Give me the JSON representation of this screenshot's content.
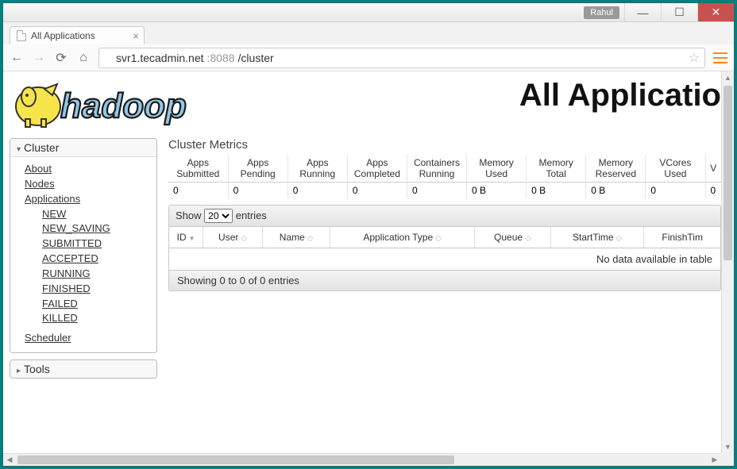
{
  "window": {
    "user_badge": "Rahul"
  },
  "browser": {
    "tab_title": "All Applications",
    "url_host": "svr1.tecadmin.net",
    "url_port": ":8088",
    "url_path": "/cluster"
  },
  "page": {
    "title": "All Applicatio",
    "logo_text": "hadoop"
  },
  "sidebar": {
    "cluster_label": "Cluster",
    "tools_label": "Tools",
    "links": {
      "about": "About",
      "nodes": "Nodes",
      "applications": "Applications",
      "scheduler": "Scheduler"
    },
    "app_states": [
      "NEW",
      "NEW_SAVING",
      "SUBMITTED",
      "ACCEPTED",
      "RUNNING",
      "FINISHED",
      "FAILED",
      "KILLED"
    ]
  },
  "metrics": {
    "section_title": "Cluster Metrics",
    "headers": [
      "Apps Submitted",
      "Apps Pending",
      "Apps Running",
      "Apps Completed",
      "Containers Running",
      "Memory Used",
      "Memory Total",
      "Memory Reserved",
      "VCores Used",
      "V"
    ],
    "values": [
      "0",
      "0",
      "0",
      "0",
      "0",
      "0 B",
      "0 B",
      "0 B",
      "0",
      "0"
    ]
  },
  "datatable": {
    "show_label_pre": "Show",
    "show_label_post": "entries",
    "page_size": "20",
    "columns": [
      "ID",
      "User",
      "Name",
      "Application Type",
      "Queue",
      "StartTime",
      "FinishTim"
    ],
    "empty_text": "No data available in table",
    "footer_text": "Showing 0 to 0 of 0 entries"
  }
}
